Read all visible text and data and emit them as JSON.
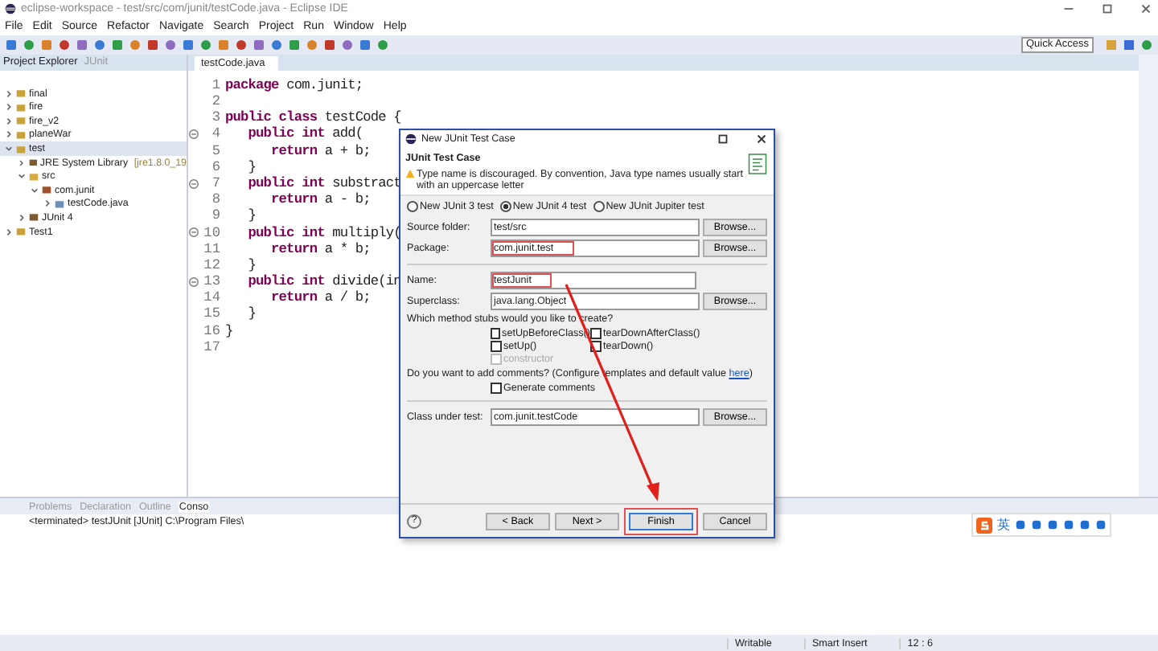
{
  "window": {
    "title": "eclipse-workspace - test/src/com/junit/testCode.java - Eclipse IDE"
  },
  "menu": [
    "File",
    "Edit",
    "Source",
    "Refactor",
    "Navigate",
    "Search",
    "Project",
    "Run",
    "Window",
    "Help"
  ],
  "quick_access": {
    "placeholder": "Quick Access"
  },
  "left_panel": {
    "tabs": [
      {
        "label": "Project Explorer",
        "selected": true
      },
      {
        "label": "JUnit",
        "selected": false
      }
    ],
    "tree": [
      {
        "label": "final",
        "kind": "project",
        "expanded": false,
        "selected": false
      },
      {
        "label": "fire",
        "kind": "project",
        "expanded": false,
        "selected": false
      },
      {
        "label": "fire_v2",
        "kind": "project",
        "expanded": false,
        "selected": false
      },
      {
        "label": "planeWar",
        "kind": "project",
        "expanded": false,
        "selected": false
      },
      {
        "label": "test",
        "kind": "project",
        "expanded": true,
        "selected": true,
        "children": [
          {
            "label": "JRE System Library",
            "decoration": "[jre1.8.0_19",
            "kind": "library",
            "expanded": false,
            "selected": false
          },
          {
            "label": "src",
            "kind": "folder",
            "expanded": true,
            "selected": false,
            "children": [
              {
                "label": "com.junit",
                "kind": "package",
                "expanded": true,
                "selected": false,
                "children": [
                  {
                    "label": "testCode.java",
                    "kind": "file",
                    "expanded": false,
                    "selected": false
                  }
                ]
              }
            ]
          },
          {
            "label": "JUnit 4",
            "kind": "library",
            "expanded": false,
            "selected": false
          }
        ]
      },
      {
        "label": "Test1",
        "kind": "project",
        "expanded": false,
        "selected": false
      }
    ]
  },
  "editor": {
    "tab": "testCode.java",
    "lines": [
      {
        "number": "1",
        "tokens": [
          {
            "text": "package",
            "kind": "keyword"
          },
          {
            "text": " com.junit;",
            "kind": "plain"
          }
        ]
      },
      {
        "number": "2"
      },
      {
        "number": "3",
        "tokens": [
          {
            "text": "public class",
            "kind": "keyword"
          },
          {
            "text": " testCode {",
            "kind": "plain"
          }
        ]
      },
      {
        "number": "4",
        "fold": true,
        "tokens": [
          {
            "text": "   public int",
            "kind": "keyword"
          },
          {
            "text": " add(",
            "kind": "plain"
          }
        ]
      },
      {
        "number": "5",
        "tokens": [
          {
            "text": "      return",
            "kind": "keyword"
          },
          {
            "text": " a + b;",
            "kind": "plain"
          }
        ]
      },
      {
        "number": "6",
        "tokens": [
          {
            "text": "   }",
            "kind": "plain"
          }
        ]
      },
      {
        "number": "7",
        "fold": true,
        "tokens": [
          {
            "text": "   public int",
            "kind": "keyword"
          },
          {
            "text": " substract",
            "kind": "plain"
          }
        ]
      },
      {
        "number": "8",
        "tokens": [
          {
            "text": "      return",
            "kind": "keyword"
          },
          {
            "text": " a - b;",
            "kind": "plain"
          }
        ]
      },
      {
        "number": "9",
        "tokens": [
          {
            "text": "   }",
            "kind": "plain"
          }
        ]
      },
      {
        "number": "10",
        "fold": true,
        "tokens": [
          {
            "text": "   public int",
            "kind": "keyword"
          },
          {
            "text": " multiply(",
            "kind": "plain"
          }
        ]
      },
      {
        "number": "11",
        "tokens": [
          {
            "text": "      return",
            "kind": "keyword"
          },
          {
            "text": " a * b;",
            "kind": "plain"
          }
        ]
      },
      {
        "number": "12",
        "tokens": [
          {
            "text": "   }",
            "kind": "plain"
          }
        ]
      },
      {
        "number": "13",
        "fold": true,
        "tokens": [
          {
            "text": "   public int",
            "kind": "keyword"
          },
          {
            "text": " divide(in",
            "kind": "plain"
          }
        ]
      },
      {
        "number": "14",
        "tokens": [
          {
            "text": "      return",
            "kind": "keyword"
          },
          {
            "text": " a / b;",
            "kind": "plain"
          }
        ]
      },
      {
        "number": "15",
        "tokens": [
          {
            "text": "   }",
            "kind": "plain"
          }
        ]
      },
      {
        "number": "16",
        "tokens": [
          {
            "text": "}",
            "kind": "plain"
          }
        ]
      },
      {
        "number": "17"
      }
    ]
  },
  "bottom_panel": {
    "tabs": [
      {
        "label": "Problems",
        "selected": false
      },
      {
        "label": "Declaration",
        "selected": false
      },
      {
        "label": "Outline",
        "selected": false
      },
      {
        "label": "Conso",
        "selected": true
      }
    ],
    "console_text": "<terminated> testJUnit [JUnit] C:\\Program Files\\"
  },
  "ime_bar": {
    "label": "英"
  },
  "status_bar": [
    "Writable",
    "Smart Insert",
    "12 : 6"
  ],
  "dialog": {
    "title": "New JUnit Test Case",
    "heading": "JUnit Test Case",
    "warning": "Type name is discouraged. By convention, Java type names usually start with an uppercase letter",
    "radios": [
      {
        "label": "New JUnit 3 test",
        "selected": false
      },
      {
        "label": "New JUnit 4 test",
        "selected": true
      },
      {
        "label": "New JUnit Jupiter test",
        "selected": false
      }
    ],
    "top_fields": [
      {
        "label": "Source folder:",
        "value": "test/src",
        "button": "Browse...",
        "highlighted": false
      },
      {
        "label": "Package:",
        "value": "com.junit.test",
        "button": "Browse...",
        "highlighted": true
      }
    ],
    "mid_fields": [
      {
        "label": "Name:",
        "value": "testJunit",
        "highlighted": true
      },
      {
        "label": "Superclass:",
        "value": "java.lang.Object",
        "button": "Browse...",
        "highlighted": false
      }
    ],
    "stubs_prompt": "Which method stubs would you like to create?",
    "stubs": [
      {
        "label": "setUpBeforeClass()",
        "checked": false,
        "disabled": false
      },
      {
        "label": "tearDownAfterClass()",
        "checked": false,
        "disabled": false
      },
      {
        "label": "setUp()",
        "checked": false,
        "disabled": false
      },
      {
        "label": "tearDown()",
        "checked": false,
        "disabled": false
      },
      {
        "label": "constructor",
        "checked": false,
        "disabled": true
      }
    ],
    "comments_prompt": "Do you want to add comments? (Configure templates and default value ",
    "comments_link": "here",
    "comments_end": ")",
    "generate_comments": {
      "label": "Generate comments",
      "checked": false
    },
    "class_under_test": {
      "label": "Class under test:",
      "value": "com.junit.testCode",
      "button": "Browse..."
    },
    "help": "?",
    "buttons": [
      {
        "label": "< Back",
        "highlighted": false
      },
      {
        "label": "Next >",
        "highlighted": false
      },
      {
        "label": "Finish",
        "highlighted": true
      },
      {
        "label": "Cancel",
        "highlighted": false
      }
    ]
  }
}
